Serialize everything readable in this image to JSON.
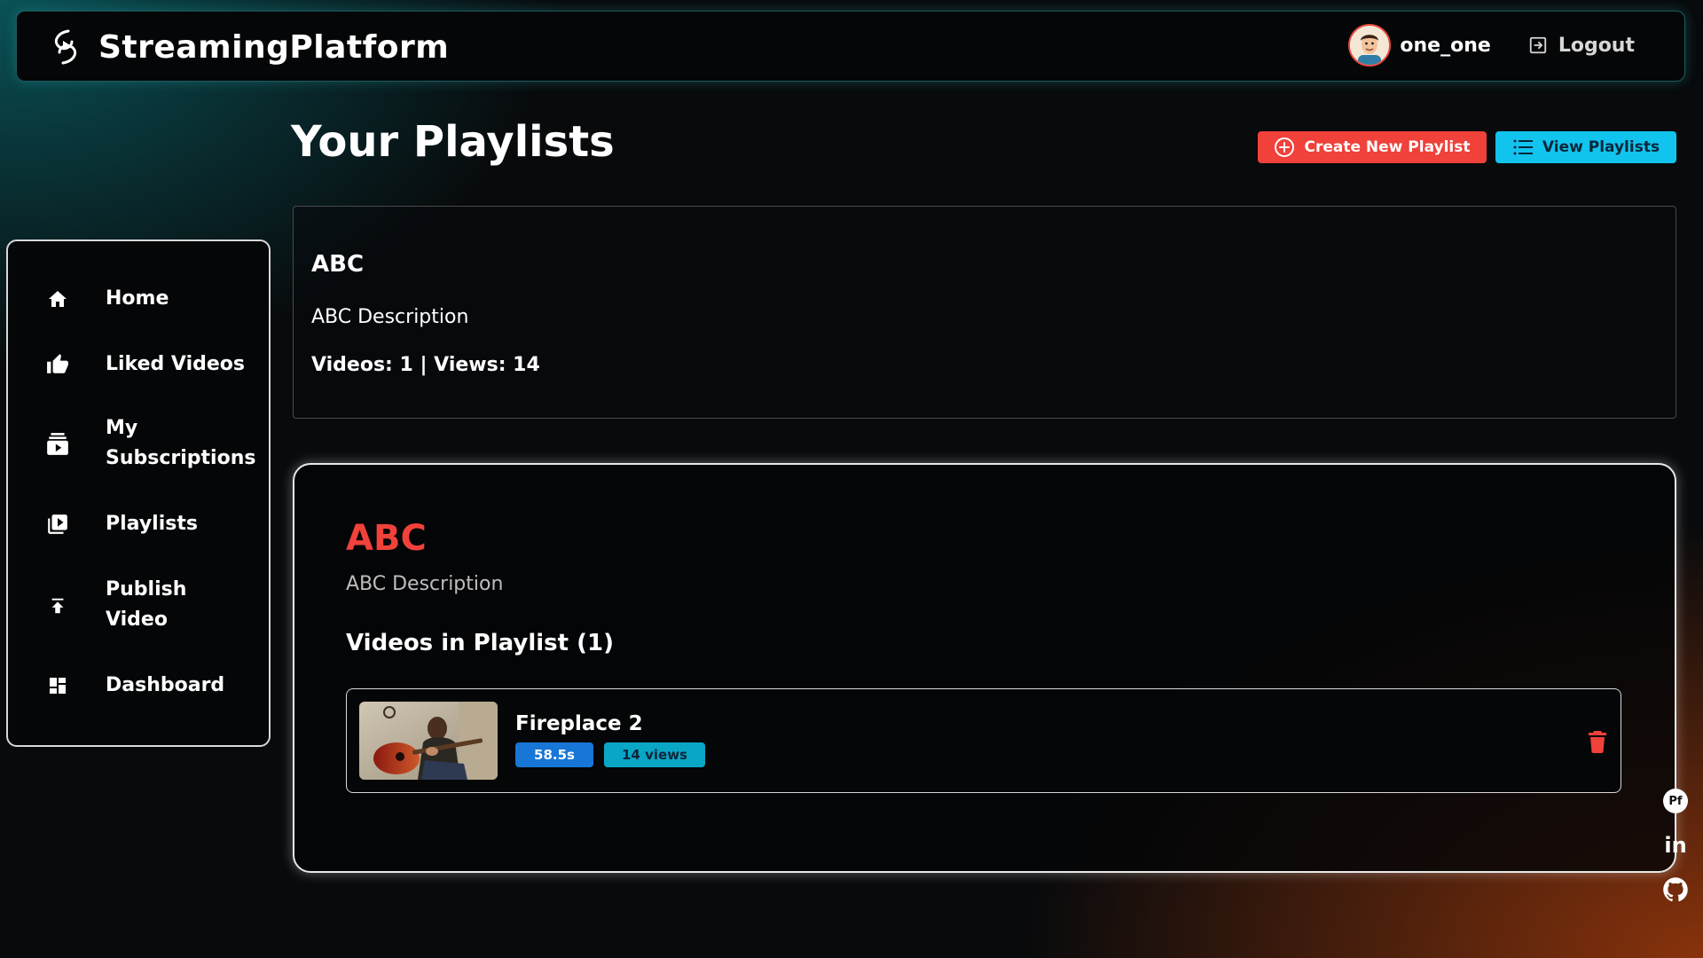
{
  "app": {
    "name": "StreamingPlatform",
    "logo_icon": "streaming-logo-icon",
    "accent_red": "#f0413a",
    "accent_cyan": "#10c4ee"
  },
  "user": {
    "username": "one_one",
    "avatar_icon": "avatar",
    "logout_label": "Logout",
    "logout_icon": "logout-icon"
  },
  "sidebar": {
    "items": [
      {
        "label": "Home",
        "icon": "home-icon"
      },
      {
        "label": "Liked Videos",
        "icon": "thumbs-up-icon"
      },
      {
        "label": "My Subscriptions",
        "icon": "subscriptions-icon"
      },
      {
        "label": "Playlists",
        "icon": "playlist-icon"
      },
      {
        "label": "Publish Video",
        "icon": "upload-icon"
      },
      {
        "label": "Dashboard",
        "icon": "dashboard-icon"
      }
    ]
  },
  "page": {
    "title": "Your Playlists",
    "create_button": "Create New Playlist",
    "view_button": "View Playlists"
  },
  "playlist_summary": {
    "name": "ABC",
    "description": "ABC Description",
    "stats": "Videos: 1 | Views: 14"
  },
  "playlist_detail": {
    "name": "ABC",
    "description": "ABC Description",
    "videos_heading": "Videos in Playlist (1)",
    "videos": [
      {
        "title": "Fireplace 2",
        "duration": "58.5s",
        "views": "14 views",
        "thumbnail_icon": "video-thumbnail",
        "delete_icon": "trash-icon"
      }
    ]
  },
  "social": [
    {
      "icon": "peerlist-icon",
      "label": "Pf"
    },
    {
      "icon": "linkedin-icon",
      "label": "in"
    },
    {
      "icon": "github-icon",
      "label": ""
    }
  ]
}
